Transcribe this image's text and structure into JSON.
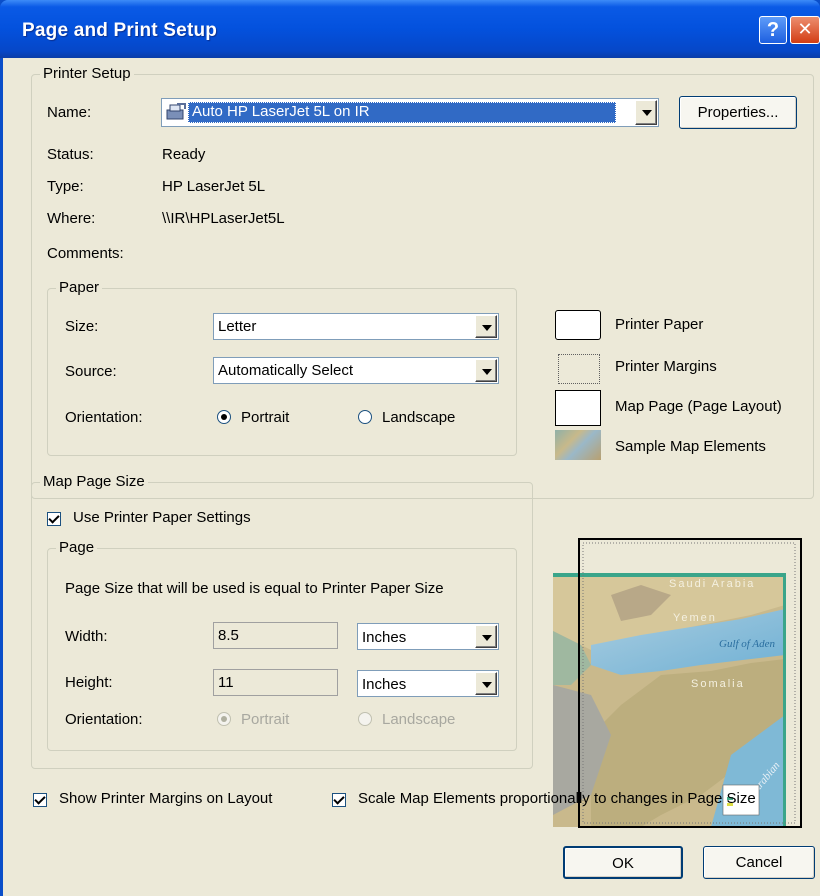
{
  "window": {
    "title": "Page and Print Setup",
    "help_glyph": "?",
    "close_glyph": "✕"
  },
  "printer_setup": {
    "group_label": "Printer Setup",
    "name_label": "Name:",
    "name_value": "Auto HP LaserJet 5L on IR",
    "properties_button": "Properties...",
    "status_label": "Status:",
    "status_value": "Ready",
    "type_label": "Type:",
    "type_value": "HP LaserJet 5L",
    "where_label": "Where:",
    "where_value": "\\\\IR\\HPLaserJet5L",
    "comments_label": "Comments:"
  },
  "paper": {
    "group_label": "Paper",
    "size_label": "Size:",
    "size_value": "Letter",
    "source_label": "Source:",
    "source_value": "Automatically Select",
    "orientation_label": "Orientation:",
    "portrait_label": "Portrait",
    "landscape_label": "Landscape",
    "orientation_selected": "Portrait"
  },
  "legend": {
    "printer_paper": "Printer Paper",
    "printer_margins": "Printer Margins",
    "map_page": "Map Page (Page Layout)",
    "sample_elements": "Sample Map Elements"
  },
  "map_page_size": {
    "group_label": "Map Page Size",
    "use_printer_settings_label": "Use Printer Paper Settings",
    "use_printer_settings_checked": true,
    "page_group_label": "Page",
    "info_text": "Page Size that will be used is equal to Printer Paper Size",
    "width_label": "Width:",
    "width_value": "8.5",
    "width_units": "Inches",
    "height_label": "Height:",
    "height_value": "11",
    "height_units": "Inches",
    "orientation_label": "Orientation:",
    "portrait_label": "Portrait",
    "landscape_label": "Landscape"
  },
  "map_preview": {
    "labels": [
      "Saudi Arabia",
      "Yemen",
      "Gulf of Aden",
      "Somalia",
      "Arabian"
    ]
  },
  "options": {
    "show_margins_label": "Show Printer Margins on Layout",
    "show_margins_checked": true,
    "scale_elements_label": "Scale Map Elements proportionally to changes in Page Size",
    "scale_elements_checked": true
  },
  "buttons": {
    "ok": "OK",
    "cancel": "Cancel"
  },
  "colors": {
    "titlebar": "#0351dd",
    "dialog_bg": "#ece9d8",
    "selection": "#316ac5"
  }
}
